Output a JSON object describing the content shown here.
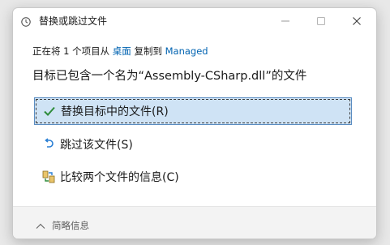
{
  "window": {
    "title": "替换或跳过文件",
    "minimize_icon": "minimize-icon",
    "maximize_icon": "maximize-icon",
    "close_icon": "close-icon"
  },
  "transfer": {
    "prefix": "正在将 1 个项目从 ",
    "source": "桌面",
    "middle": " 复制到 ",
    "destination": "Managed"
  },
  "heading": "目标已包含一个名为“Assembly-CSharp.dll”的文件",
  "options": [
    {
      "label": "替换目标中的文件(R)",
      "icon": "checkmark-icon",
      "selected": true
    },
    {
      "label": "跳过该文件(S)",
      "icon": "skip-undo-icon",
      "selected": false
    },
    {
      "label": "比较两个文件的信息(C)",
      "icon": "compare-files-icon",
      "selected": false
    }
  ],
  "footer": {
    "toggle_label": "简略信息",
    "toggle_icon": "chevron-up-icon"
  },
  "colors": {
    "accent": "#0063b1",
    "selected_bg": "#cfe3f5",
    "selected_border": "#5a8dc2"
  }
}
